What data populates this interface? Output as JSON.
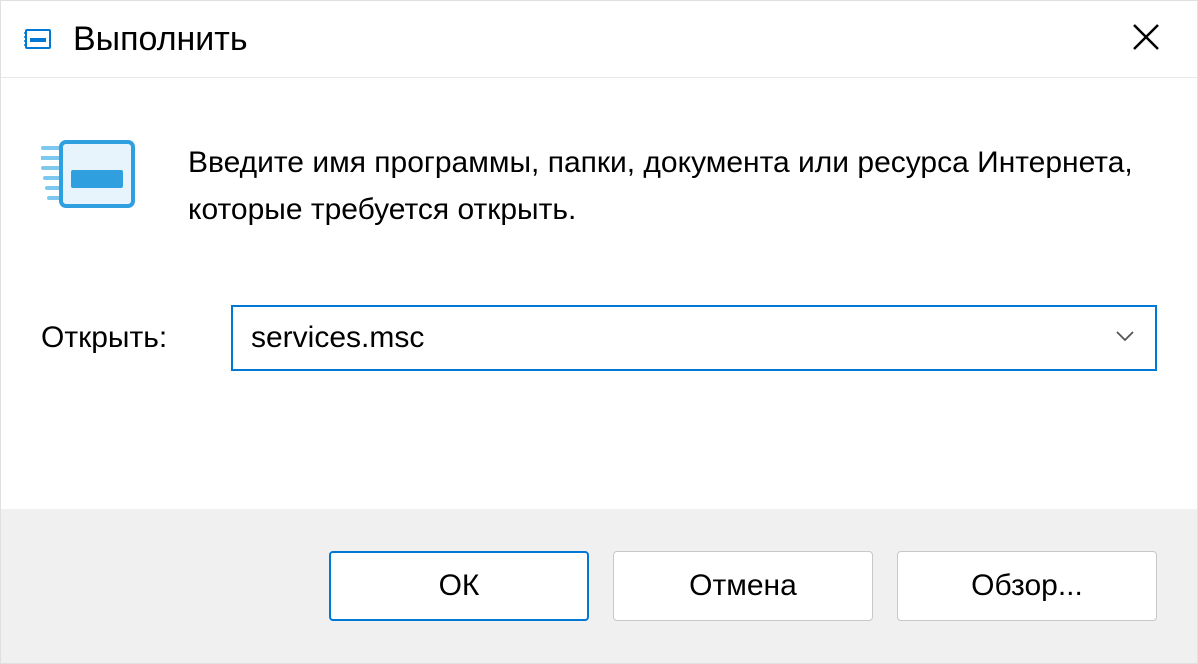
{
  "titlebar": {
    "title": "Выполнить"
  },
  "content": {
    "description": "Введите имя программы, папки, документа или ресурса Интернета, которые требуется открыть.",
    "open_label": "Открыть:",
    "input_value": "services.msc"
  },
  "footer": {
    "ok_label": "ОК",
    "cancel_label": "Отмена",
    "browse_label": "Обзор..."
  }
}
